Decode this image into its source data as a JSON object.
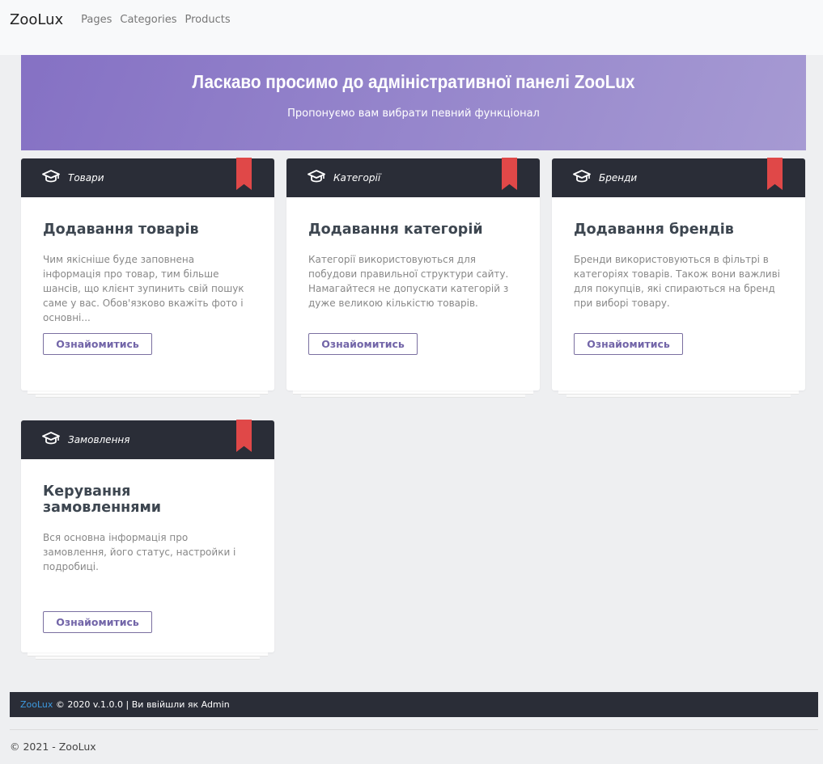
{
  "nav": {
    "brand": "ZooLux",
    "links": [
      "Pages",
      "Categories",
      "Products"
    ]
  },
  "banner": {
    "title": "Ласкаво просимо до адміністративної панелі ZooLux",
    "subtitle": "Пропонуємо вам вибрати певний функціонал"
  },
  "cards": [
    {
      "tag": "Товари",
      "title": "Додавання товарів",
      "text": "Чим якісніше буде заповнена інформація про товар, тим більше шансів, що клієнт зупинить свій пошук саме у вас. Обов'язково вкажіть фото і основні...",
      "button": "Ознайомитись"
    },
    {
      "tag": "Категорії",
      "title": "Додавання категорій",
      "text": "Категорії використовуються для побудови правильної структури сайту. Намагайтеся не допускати категорій з дуже великою кількістю товарів.",
      "button": "Ознайомитись"
    },
    {
      "tag": "Бренди",
      "title": "Додавання брендів",
      "text": "Бренди використовуються в фільтрі в категоріях товарів. Також вони важливі для покупців, які спираються на бренд при виборі товару.",
      "button": "Ознайомитись"
    },
    {
      "tag": "Замовлення",
      "title": "Керування замовленнями",
      "text": "Вся основна інформація про замовлення, його статус, настройки і подробиці.",
      "button": "Ознайомитись"
    }
  ],
  "footer": {
    "brand": "ZooLux",
    "text": " © 2020 v.1.0.0 | Ви ввійшли як Admin",
    "copyright": "© 2021 - ZooLux"
  },
  "colors": {
    "accent": "#8571c4",
    "dark": "#2a2d37",
    "bookmark": "#e04848"
  }
}
